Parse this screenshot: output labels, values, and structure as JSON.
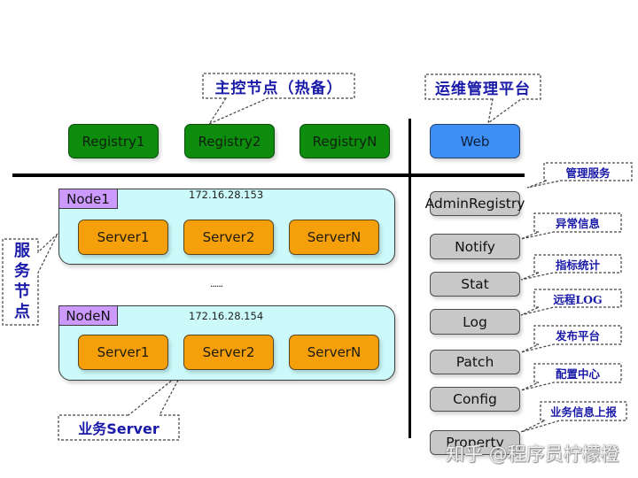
{
  "master_nodes": {
    "callout": "主控节点（热备）",
    "registries": [
      "Registry1",
      "Registry2",
      "RegistryN"
    ]
  },
  "ops_platform": {
    "callout": "运维管理平台",
    "web": "Web"
  },
  "service_nodes": {
    "callout": "服务节点",
    "nodes": [
      {
        "label": "Node1",
        "ip": "172.16.28.153",
        "servers": [
          "Server1",
          "Server2",
          "ServerN"
        ]
      },
      {
        "label": "NodeN",
        "ip": "172.16.28.154",
        "servers": [
          "Server1",
          "Server2",
          "ServerN"
        ]
      }
    ],
    "ellipsis": "......",
    "server_callout": "业务Server"
  },
  "services": [
    {
      "name": "AdminRegistry",
      "callout": "管理服务"
    },
    {
      "name": "Notify",
      "callout": "异常信息"
    },
    {
      "name": "Stat",
      "callout": "指标统计"
    },
    {
      "name": "Log",
      "callout": "远程LOG"
    },
    {
      "name": "Patch",
      "callout": "发布平台"
    },
    {
      "name": "Config",
      "callout": "配置中心"
    },
    {
      "name": "Property",
      "callout": "业务信息上报"
    }
  ],
  "watermark": "知乎 @程序员柠檬橙",
  "colors": {
    "registry": "#0e8c0e",
    "web": "#3d8ff5",
    "server": "#f5a00a",
    "node_bg": "#ccfafa",
    "node_label": "#cc99ff",
    "service_box": "#c8c8c8",
    "callout_text": "#1a1aa8",
    "axis_line": "#000000"
  }
}
